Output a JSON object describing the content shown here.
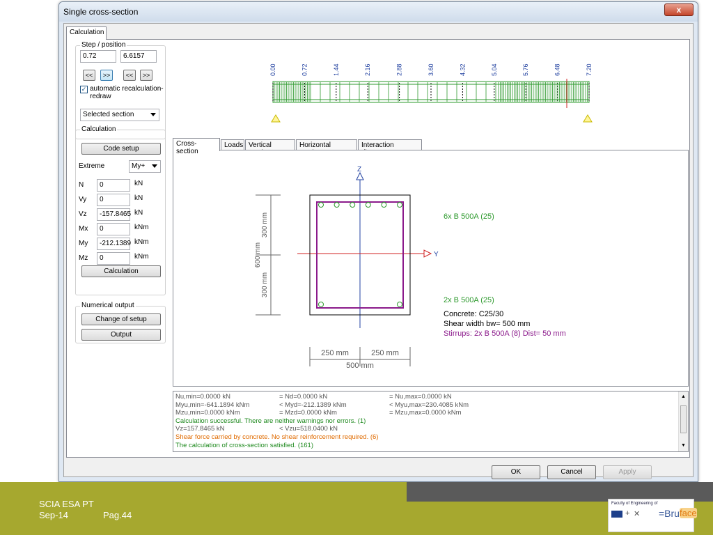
{
  "window": {
    "title": "Single cross-section",
    "close_glyph": "x"
  },
  "main_tab": "Calculation",
  "step_position": {
    "group_label": "Step / position",
    "step": "0.72",
    "position": "6.6157",
    "btn_prev": "<<",
    "btn_next": ">>",
    "btn_prev2": "<<",
    "btn_next2": ">>"
  },
  "auto_recalc": {
    "label": "automatic recalculation-redraw",
    "checked": true
  },
  "section_combo": "Selected section",
  "calculation": {
    "group_label": "Calculation",
    "code_setup": "Code setup",
    "extreme_label": "Extreme",
    "extreme_combo": "My+",
    "rows": [
      {
        "name": "N",
        "value": "0",
        "unit": "kN"
      },
      {
        "name": "Vy",
        "value": "0",
        "unit": "kN"
      },
      {
        "name": "Vz",
        "value": "-157.8465",
        "unit": "kN"
      },
      {
        "name": "Mx",
        "value": "0",
        "unit": "kNm"
      },
      {
        "name": "My",
        "value": "-212.1389",
        "unit": "kNm"
      },
      {
        "name": "Mz",
        "value": "0",
        "unit": "kNm"
      }
    ],
    "calc_button": "Calculation"
  },
  "numerical_output": {
    "group_label": "Numerical output",
    "change_setup": "Change of setup",
    "output": "Output"
  },
  "beam_ticks": [
    "0.00",
    "0.72",
    "1.44",
    "2.16",
    "2.88",
    "3.60",
    "4.32",
    "5.04",
    "5.76",
    "6.48",
    "7.20"
  ],
  "sub_tabs": [
    "Cross-section",
    "Loads",
    "Vertical section",
    "Horizontal section",
    "Interaction diagram"
  ],
  "cross_section": {
    "axis_z": "Z",
    "axis_y": "Y",
    "dim_height": "600 mm",
    "dim_half1": "300 mm",
    "dim_half2": "300 mm",
    "dim_w1": "250 mm",
    "dim_w2": "250 mm",
    "dim_width": "500 mm",
    "top_rebar": "6x B 500A (25)",
    "bottom_rebar": "2x B 500A (25)",
    "concrete": "Concrete: C25/30",
    "shear_width": "Shear width bw= 500 mm",
    "stirrups": "Stirrups: 2x B 500A (8) Dist= 50 mm",
    "color_green": "#2e9a2e",
    "color_purple": "#8b1a8b"
  },
  "output_lines": [
    {
      "c1": "Nu,min=0.0000 kN",
      "c2": "= Nd=0.0000 kN",
      "c3": "= Nu,max=0.0000 kN",
      "color": "#555555"
    },
    {
      "c1": "Myu,min=-641.1894 kNm",
      "c2": "< Myd=-212.1389 kNm",
      "c3": "< Myu,max=230.4085 kNm",
      "color": "#555555"
    },
    {
      "c1": "Mzu,min=0.0000 kNm",
      "c2": "= Mzd=0.0000 kNm",
      "c3": "= Mzu,max=0.0000 kNm",
      "color": "#555555"
    },
    {
      "c1": "Calculation successful. There are neither warnings nor errors. (1)",
      "c2": "",
      "c3": "",
      "color": "#1f8a1f"
    },
    {
      "c1": "Vz=157.8465 kN",
      "c2": "< Vzu=518.0400 kN",
      "c3": "",
      "color": "#555555"
    },
    {
      "c1": "Shear force carried by concrete. No shear reinforcement required. (6)",
      "c2": "",
      "c3": "",
      "color": "#e06b00"
    },
    {
      "c1": "The calculation of cross-section satisfied. (161)",
      "c2": "",
      "c3": "",
      "color": "#1f8a1f"
    }
  ],
  "dialog_buttons": {
    "ok": "OK",
    "cancel": "Cancel",
    "apply": "Apply"
  },
  "footer": {
    "line1": "SCIA ESA PT",
    "date": "Sep-14",
    "page": "Pag.44",
    "logo_text": "Faculty of Engineering of",
    "logo_brand": "=Bru",
    "logo_brand2": "face"
  }
}
